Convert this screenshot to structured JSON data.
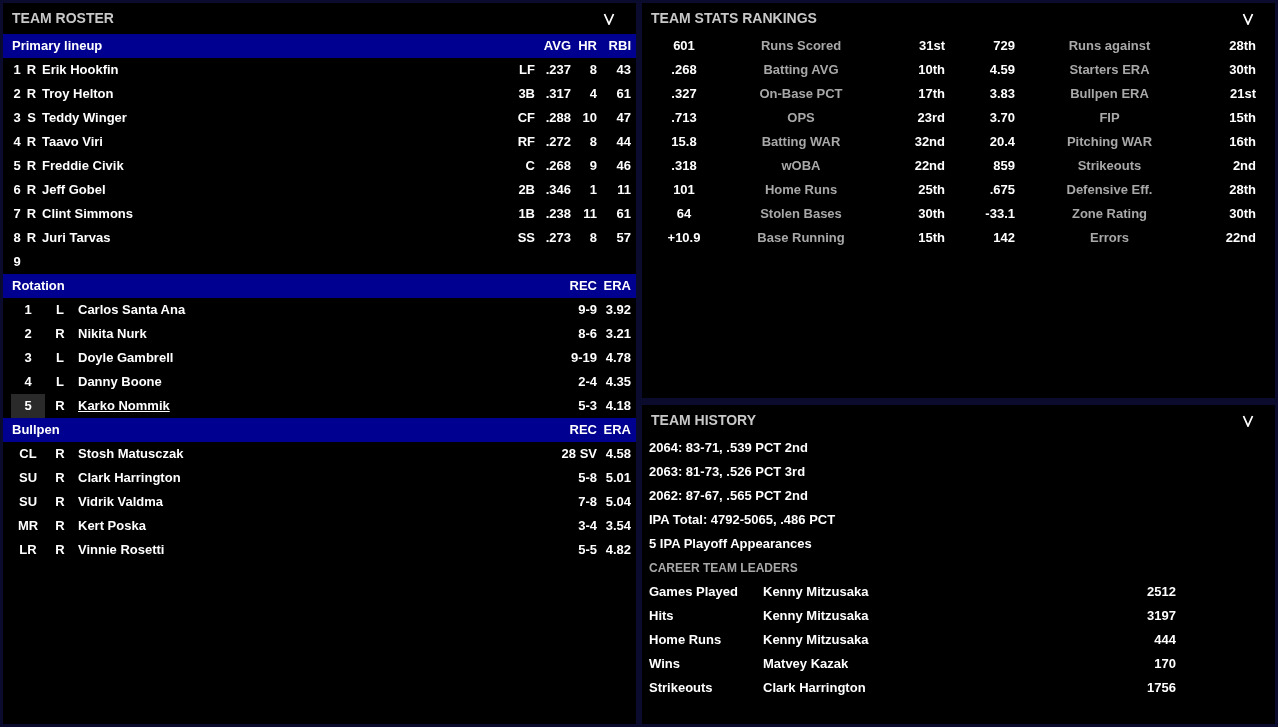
{
  "roster": {
    "title": "TEAM ROSTER",
    "lineup": {
      "title": "Primary lineup",
      "columns": [
        "AVG",
        "HR",
        "RBI"
      ],
      "rows": [
        {
          "slot": "1",
          "hand": "R",
          "name": "Erik Hookfin",
          "pos": "LF",
          "avg": ".237",
          "hr": "8",
          "rbi": "43",
          "selected": false
        },
        {
          "slot": "2",
          "hand": "R",
          "name": "Troy Helton",
          "pos": "3B",
          "avg": ".317",
          "hr": "4",
          "rbi": "61",
          "selected": false
        },
        {
          "slot": "3",
          "hand": "S",
          "name": "Teddy Winger",
          "pos": "CF",
          "avg": ".288",
          "hr": "10",
          "rbi": "47",
          "selected": false
        },
        {
          "slot": "4",
          "hand": "R",
          "name": "Taavo Viri",
          "pos": "RF",
          "avg": ".272",
          "hr": "8",
          "rbi": "44",
          "selected": false
        },
        {
          "slot": "5",
          "hand": "R",
          "name": "Freddie Civik",
          "pos": "C",
          "avg": ".268",
          "hr": "9",
          "rbi": "46",
          "selected": false
        },
        {
          "slot": "6",
          "hand": "R",
          "name": "Jeff Gobel",
          "pos": "2B",
          "avg": ".346",
          "hr": "1",
          "rbi": "11",
          "selected": false
        },
        {
          "slot": "7",
          "hand": "R",
          "name": "Clint Simmons",
          "pos": "1B",
          "avg": ".238",
          "hr": "11",
          "rbi": "61",
          "selected": false
        },
        {
          "slot": "8",
          "hand": "R",
          "name": "Juri Tarvas",
          "pos": "SS",
          "avg": ".273",
          "hr": "8",
          "rbi": "57",
          "selected": false
        },
        {
          "slot": "9",
          "selected": false
        }
      ]
    },
    "rotation": {
      "title": "Rotation",
      "columns": [
        "REC",
        "ERA"
      ],
      "rows": [
        {
          "slot": "1",
          "hand": "L",
          "name": "Carlos Santa Ana",
          "rec": "9-9",
          "era": "3.92",
          "selected": false
        },
        {
          "slot": "2",
          "hand": "R",
          "name": "Nikita Nurk",
          "rec": "8-6",
          "era": "3.21",
          "selected": false
        },
        {
          "slot": "3",
          "hand": "L",
          "name": "Doyle Gambrell",
          "rec": "9-19",
          "era": "4.78",
          "selected": false
        },
        {
          "slot": "4",
          "hand": "L",
          "name": "Danny Boone",
          "rec": "2-4",
          "era": "4.35",
          "selected": false
        },
        {
          "slot": "5",
          "hand": "R",
          "name": "Karko Nommik",
          "rec": "5-3",
          "era": "4.18",
          "selected": true
        }
      ]
    },
    "bullpen": {
      "title": "Bullpen",
      "columns": [
        "REC",
        "ERA"
      ],
      "rows": [
        {
          "slot": "CL",
          "hand": "R",
          "name": "Stosh Matusczak",
          "rec": "28 SV",
          "era": "4.58",
          "selected": false
        },
        {
          "slot": "SU",
          "hand": "R",
          "name": "Clark Harrington",
          "rec": "5-8",
          "era": "5.01",
          "selected": false
        },
        {
          "slot": "SU",
          "hand": "R",
          "name": "Vidrik Valdma",
          "rec": "7-8",
          "era": "5.04",
          "selected": false
        },
        {
          "slot": "MR",
          "hand": "R",
          "name": "Kert Poska",
          "rec": "3-4",
          "era": "3.54",
          "selected": false
        },
        {
          "slot": "LR",
          "hand": "R",
          "name": "Vinnie Rosetti",
          "rec": "5-5",
          "era": "4.82",
          "selected": false
        }
      ]
    }
  },
  "rankings": {
    "title": "TEAM STATS RANKINGS",
    "rows": [
      {
        "value": "601",
        "label": "Runs Scored",
        "rank": "31st",
        "value_2": "729",
        "label_2": "Runs against",
        "rank_2": "28th"
      },
      {
        "value": ".268",
        "label": "Batting AVG",
        "rank": "10th",
        "value_2": "4.59",
        "label_2": "Starters ERA",
        "rank_2": "30th"
      },
      {
        "value": ".327",
        "label": "On-Base PCT",
        "rank": "17th",
        "value_2": "3.83",
        "label_2": "Bullpen ERA",
        "rank_2": "21st"
      },
      {
        "value": ".713",
        "label": "OPS",
        "rank": "23rd",
        "value_2": "3.70",
        "label_2": "FIP",
        "rank_2": "15th"
      },
      {
        "value": "15.8",
        "label": "Batting WAR",
        "rank": "32nd",
        "value_2": "20.4",
        "label_2": "Pitching WAR",
        "rank_2": "16th"
      },
      {
        "value": ".318",
        "label": "wOBA",
        "rank": "22nd",
        "value_2": "859",
        "label_2": "Strikeouts",
        "rank_2": "2nd"
      },
      {
        "value": "101",
        "label": "Home Runs",
        "rank": "25th",
        "value_2": ".675",
        "label_2": "Defensive Eff.",
        "rank_2": "28th"
      },
      {
        "value": "64",
        "label": "Stolen Bases",
        "rank": "30th",
        "value_2": "-33.1",
        "label_2": "Zone Rating",
        "rank_2": "30th"
      },
      {
        "value": "+10.9",
        "label": "Base Running",
        "rank": "15th",
        "value_2": "142",
        "label_2": "Errors",
        "rank_2": "22nd"
      }
    ]
  },
  "history": {
    "title": "TEAM HISTORY",
    "lines": [
      "2064: 83-71, .539 PCT 2nd",
      "2063: 81-73, .526 PCT 3rd",
      "2062: 87-67, .565 PCT 2nd",
      "IPA Total: 4792-5065, .486 PCT",
      "5 IPA Playoff Appearances"
    ],
    "leaders_title": "CAREER TEAM LEADERS",
    "leaders": [
      {
        "stat": "Games Played",
        "player": "Kenny Mitzusaka",
        "value": "2512"
      },
      {
        "stat": "Hits",
        "player": "Kenny Mitzusaka",
        "value": "3197"
      },
      {
        "stat": "Home Runs",
        "player": "Kenny Mitzusaka",
        "value": "444"
      },
      {
        "stat": "Wins",
        "player": "Matvey Kazak",
        "value": "170"
      },
      {
        "stat": "Strikeouts",
        "player": "Clark Harrington",
        "value": "1756"
      }
    ]
  }
}
